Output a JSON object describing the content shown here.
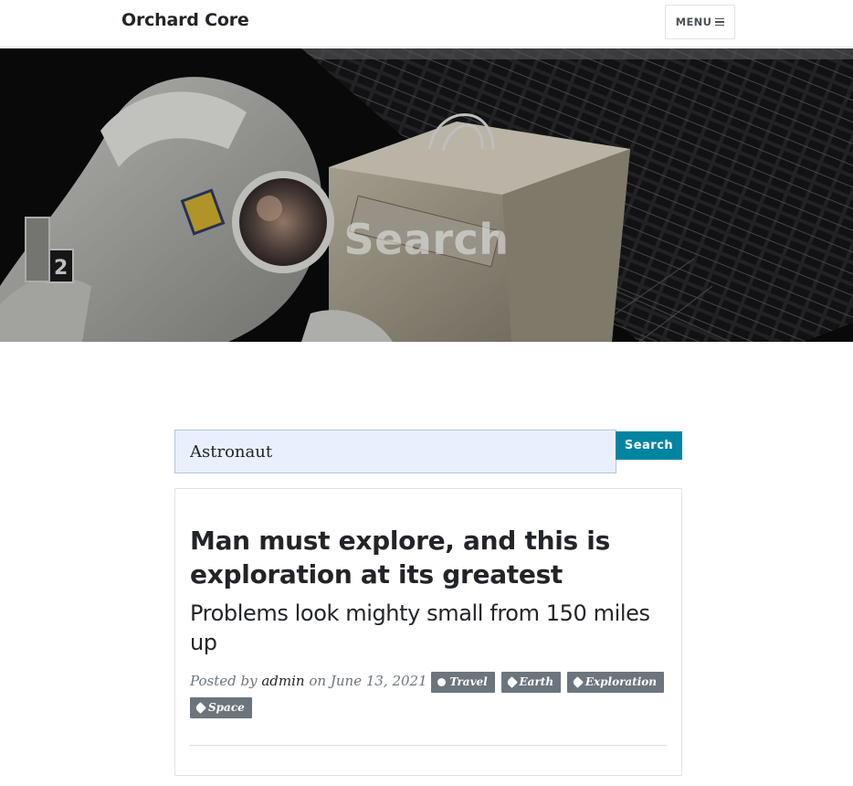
{
  "navbar": {
    "brand": "Orchard Core",
    "menu_label": "MENU"
  },
  "header": {
    "title": "Search"
  },
  "search": {
    "value": "Astronaut",
    "button_label": "Search"
  },
  "result": {
    "title": "Man must explore, and this is exploration at its greatest",
    "subtitle": "Problems look mighty small from 150 miles up",
    "posted_by_prefix": "Posted by",
    "author": "admin",
    "date_prefix": "on",
    "date": "June 13, 2021",
    "category": "Travel",
    "tags": [
      "Earth",
      "Exploration",
      "Space"
    ]
  },
  "colors": {
    "accent": "#0085a1",
    "tag_bg": "#6c757d",
    "input_bg": "#e8f0fe"
  },
  "icons": {
    "menu": "hamburger-icon",
    "category": "category-icon",
    "tag": "tag-icon"
  }
}
